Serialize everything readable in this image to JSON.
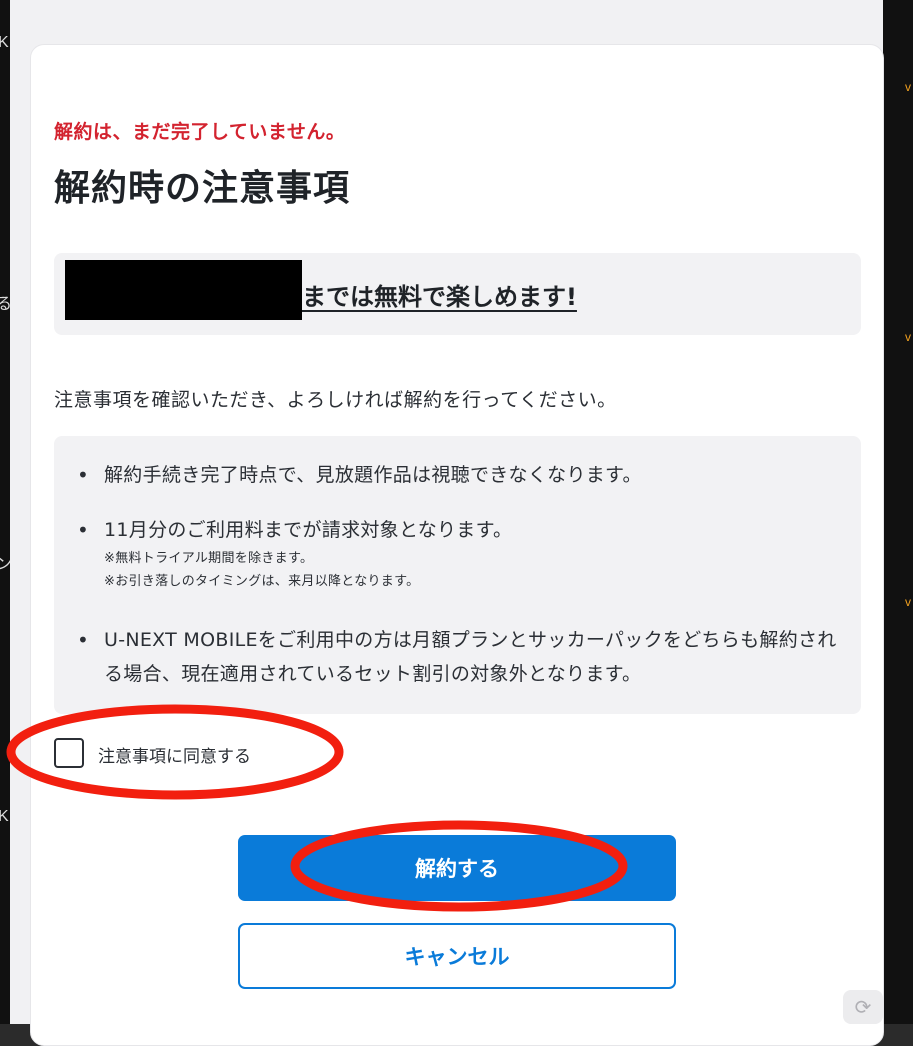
{
  "dialog": {
    "warning": "解約は、まだ完了していません。",
    "title": "解約時の注意事項",
    "free_period": {
      "text": "までは無料で楽しめます!"
    },
    "intro": "注意事項を確認いただき、よろしければ解約を行ってください。",
    "notes": [
      {
        "text": "解約手続き完了時点で、見放題作品は視聴できなくなります。"
      },
      {
        "text": "11月分のご利用料までが請求対象となります。",
        "sub": [
          "※無料トライアル期間を除きます。",
          "※お引き落しのタイミングは、来月以降となります。"
        ]
      },
      {
        "text": "U-NEXT MOBILEをご利用中の方は月額プランとサッカーパックをどちらも解約される場合、現在適用されているセット割引の対象外となります。"
      }
    ],
    "agree_label": "注意事項に同意する",
    "agree_checked": false,
    "confirm_button": "解約する",
    "cancel_button": "キャンセル"
  },
  "background": {
    "left_glyphs": [
      "K",
      "る",
      "ン",
      "K"
    ],
    "right_glyphs": [
      "v",
      "v",
      "v"
    ]
  },
  "colors": {
    "warning": "#d3232f",
    "primary": "#0a7bd9",
    "annotation": "#f21f0f",
    "panel": "#f2f2f4"
  },
  "icons": {
    "bullet": "•",
    "refresh": "refresh-icon"
  }
}
